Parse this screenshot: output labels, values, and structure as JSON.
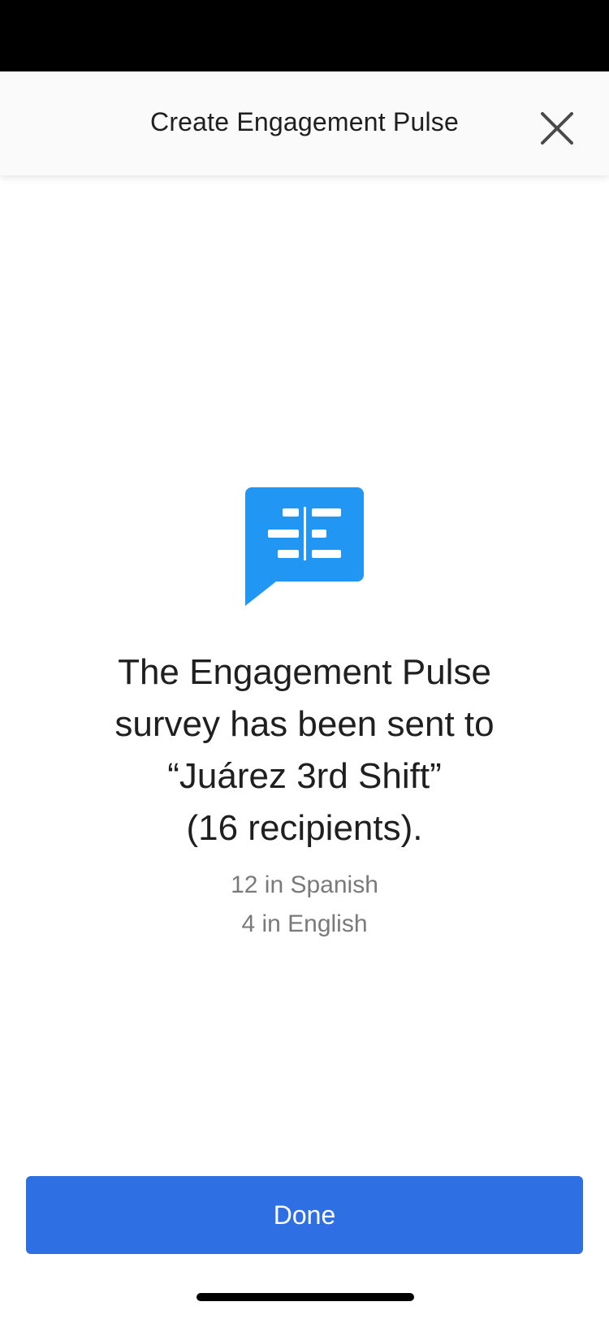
{
  "header": {
    "title": "Create Engagement Pulse",
    "close_icon": "close-icon"
  },
  "confirmation": {
    "icon": "survey-chat-icon",
    "icon_color": "#2196F3",
    "message_lines": [
      "The Engagement Pulse",
      "survey has been sent to",
      "“Juárez 3rd Shift”",
      "(16 recipients)."
    ],
    "counts": [
      "12 in Spanish",
      "4 in English"
    ]
  },
  "footer": {
    "done_label": "Done",
    "button_color": "#2F6FE4"
  }
}
